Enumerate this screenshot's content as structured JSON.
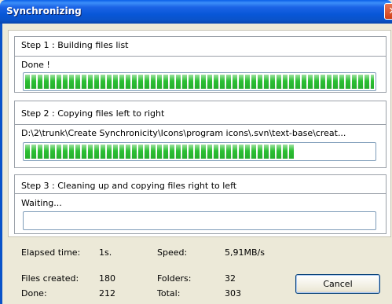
{
  "window": {
    "title": "Synchronizing",
    "close_glyph": "✕"
  },
  "steps": [
    {
      "title": "Step 1 : Building files list",
      "status": "Done !",
      "progress": 1.0
    },
    {
      "title": "Step 2 : Copying files left to right",
      "status": "D:\\2\\trunk\\Create Synchronicity\\Icons\\program icons\\.svn\\text-base\\creat...",
      "progress": 0.77
    },
    {
      "title": "Step 3 : Cleaning up and copying files right to left",
      "status": "Waiting...",
      "progress": 0
    }
  ],
  "stats": {
    "elapsed_label": "Elapsed time:",
    "elapsed_value": "1s.",
    "speed_label": "Speed:",
    "speed_value": "5,91MB/s",
    "files_created_label": "Files created:",
    "files_created_value": "180",
    "folders_label": "Folders:",
    "folders_value": "32",
    "done_label": "Done:",
    "done_value": "212",
    "total_label": "Total:",
    "total_value": "303"
  },
  "buttons": {
    "cancel": "Cancel"
  },
  "colors": {
    "progress": "#2bbf33",
    "titlebar": "#0a53c9",
    "window_bg": "#ece9d8"
  }
}
